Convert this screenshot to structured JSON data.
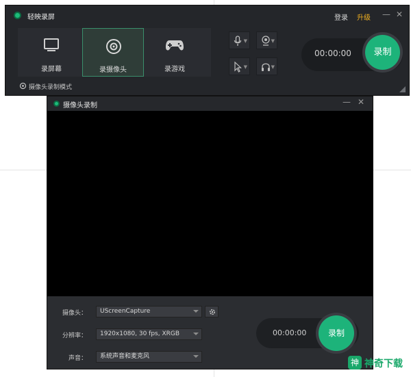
{
  "app": {
    "title": "轻映录屏",
    "login_label": "登录",
    "upgrade_label": "升级",
    "minimize_icon": "minimize-icon",
    "close_icon": "close-icon"
  },
  "modes": [
    {
      "label": "录屏幕",
      "icon": "monitor-icon",
      "active": false
    },
    {
      "label": "录摄像头",
      "icon": "camera-lens-icon",
      "active": true
    },
    {
      "label": "录游戏",
      "icon": "gamepad-icon",
      "active": false
    }
  ],
  "tools": {
    "microphone": "microphone-icon",
    "webcam": "webcam-icon",
    "cursor": "cursor-icon",
    "headphones": "headphones-icon"
  },
  "recorder": {
    "time": "00:00:00",
    "record_label": "录制"
  },
  "mode_tip": "摄像头录制模式",
  "camera_window": {
    "title": "摄像头录制",
    "camera_label": "摄像头：",
    "camera_value": "UScreenCapture",
    "resolution_label": "分辨率：",
    "resolution_value": "1920x1080, 30 fps, XRGB",
    "audio_label": "声音：",
    "audio_value": "系统声音和麦克风",
    "time": "00:00:00",
    "record_label": "录制"
  },
  "watermark": {
    "text": "神奇下载",
    "mark": "神"
  },
  "colors": {
    "accent": "#1db37a",
    "upgrade": "#f0b021",
    "window_bg": "#24262a",
    "preview_bg": "#000000"
  }
}
